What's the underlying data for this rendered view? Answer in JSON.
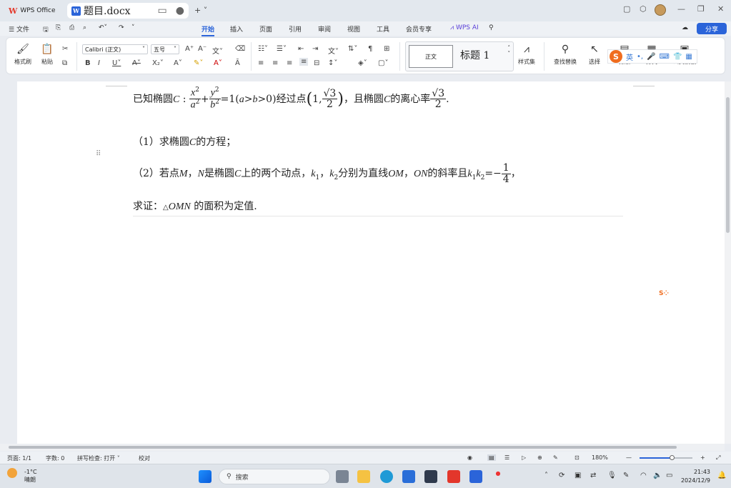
{
  "window": {
    "wps_tab": "WPS Office",
    "doc_tab": "题目.docx"
  },
  "menu": {
    "file": "文件",
    "items": [
      "开始",
      "插入",
      "页面",
      "引用",
      "审阅",
      "视图",
      "工具",
      "会员专享"
    ],
    "wps_ai": "WPS AI",
    "share": "分享"
  },
  "ribbon": {
    "format_painter": "格式刷",
    "paste": "粘贴",
    "font": "Calibri (正文)",
    "size": "五号",
    "style_normal": "正文",
    "style_heading": "标题 1",
    "style_set": "样式集",
    "find_replace": "查找替换",
    "select": "选择",
    "layout": "排版",
    "typeset": "排列",
    "doc_assist": "公文模板"
  },
  "ime": {
    "mode": "英"
  },
  "doc": {
    "p1": {
      "prefix": "已知椭圆",
      "mid": "经过点",
      "mid2": "，且椭圆",
      "mid3": "的离心率",
      "end": "."
    },
    "p2": {
      "label": "（1）求椭圆",
      "tail": "的方程；"
    },
    "p3": {
      "label": "（2）若点",
      "t1": "，",
      "t2": "是椭圆",
      "t3": "上的两个动点，",
      "t4": "，",
      "t5": "分别为直线",
      "t6": "，",
      "t7": "的斜率且",
      "t8": "，"
    },
    "p4": {
      "label": "求证：",
      "tail": "的面积为定值."
    }
  },
  "status": {
    "page": "页面: 1/1",
    "words": "字数: 0",
    "spell": "拼写检查: 打开",
    "proof": "校对",
    "zoom": "180%"
  },
  "taskbar": {
    "search": "搜索",
    "temp": "-1°C",
    "weather": "晴朗",
    "time": "21:43",
    "date": "2024/12/9"
  }
}
